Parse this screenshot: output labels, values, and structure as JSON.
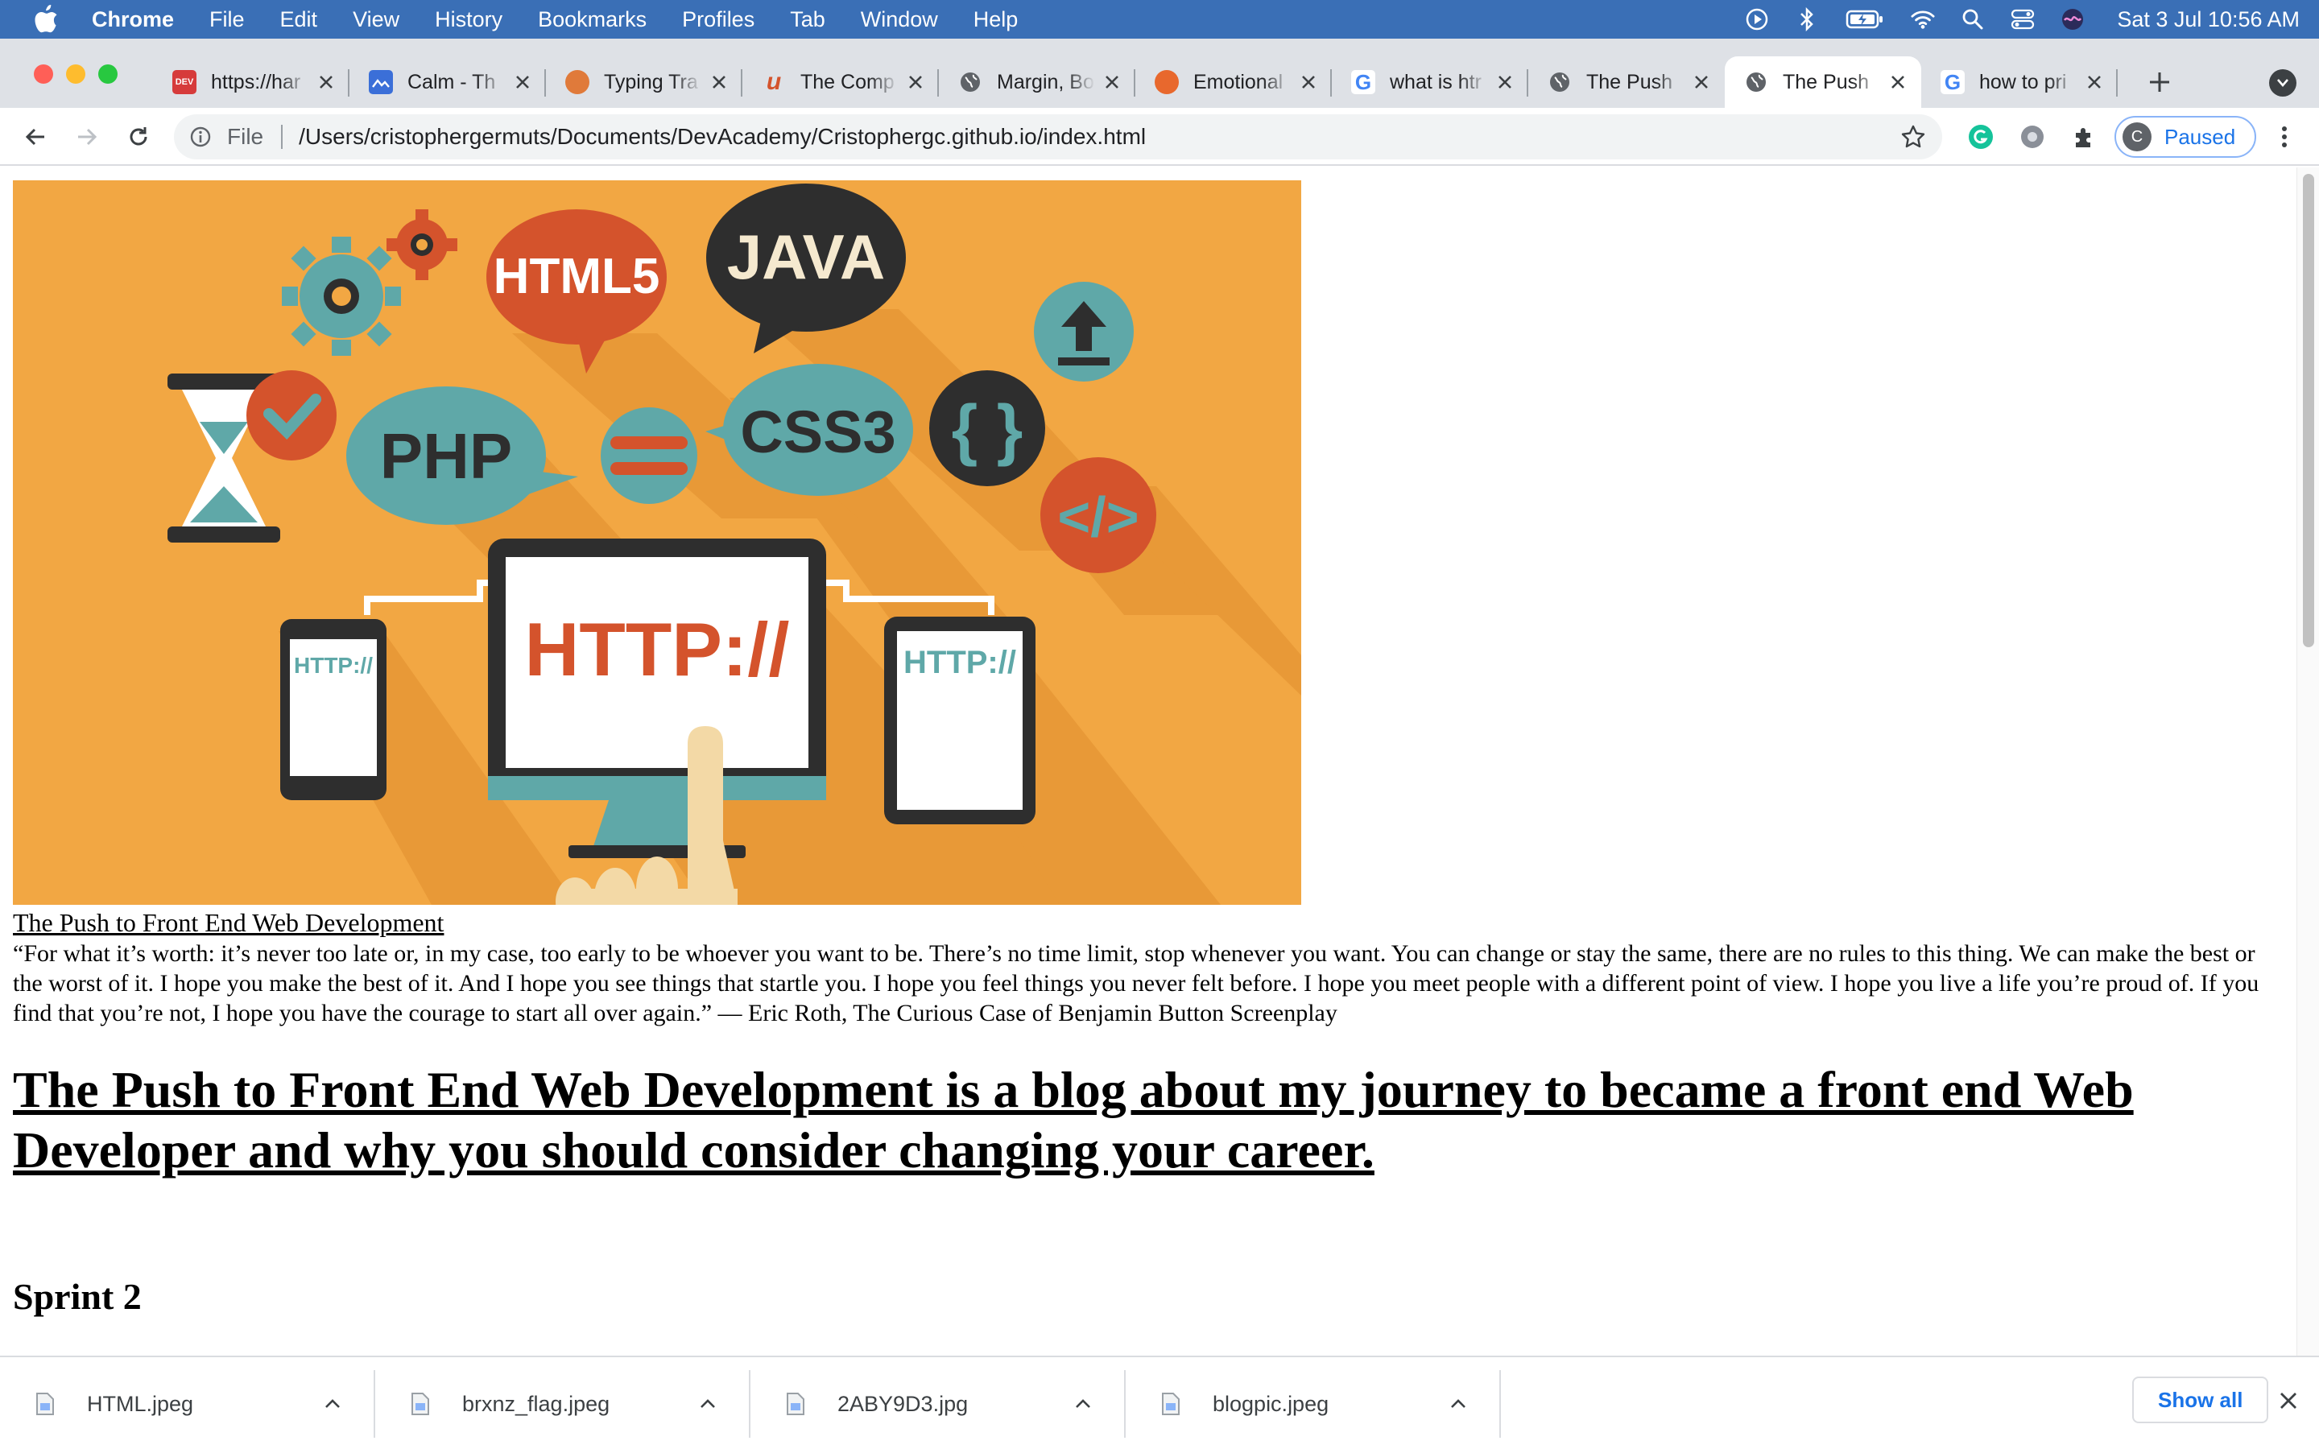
{
  "menubar": {
    "app_name": "Chrome",
    "items": [
      "File",
      "Edit",
      "View",
      "History",
      "Bookmarks",
      "Profiles",
      "Tab",
      "Window",
      "Help"
    ],
    "clock": "Sat 3 Jul  10:56 AM"
  },
  "tabs": [
    {
      "title": "https://har",
      "favicon": "dev-icon",
      "favicon_color": "#d63b3b",
      "favicon_text": "DEV"
    },
    {
      "title": "Calm - Th",
      "favicon": "calm-icon",
      "favicon_color": "#3b6fd8",
      "favicon_text": ""
    },
    {
      "title": "Typing Tra",
      "favicon": "typing-icon",
      "favicon_color": "#e07a3a",
      "favicon_text": ""
    },
    {
      "title": "The Comp",
      "favicon": "udemy-icon",
      "favicon_color": "#ffffff",
      "favicon_text": "u"
    },
    {
      "title": "Margin, Bo",
      "favicon": "globe-icon",
      "favicon_color": "#ffffff",
      "favicon_text": ""
    },
    {
      "title": "Emotional",
      "favicon": "speech-icon",
      "favicon_color": "#e8682d",
      "favicon_text": ""
    },
    {
      "title": "what is htr",
      "favicon": "google-icon",
      "favicon_color": "#ffffff",
      "favicon_text": "G"
    },
    {
      "title": "The Push",
      "favicon": "globe-icon",
      "favicon_color": "#ffffff",
      "favicon_text": ""
    },
    {
      "title": "The Push",
      "favicon": "globe-icon",
      "favicon_color": "#ffffff",
      "favicon_text": "",
      "active": true
    },
    {
      "title": "how to pri",
      "favicon": "google-icon",
      "favicon_color": "#ffffff",
      "favicon_text": "G"
    }
  ],
  "toolbar": {
    "scheme": "File",
    "url": "/Users/cristophergermuts/Documents/DevAcademy/Cristophergc.github.io/index.html",
    "profile_initial": "C",
    "profile_label": "Paused"
  },
  "page": {
    "hero_labels": {
      "html5": "HTML5",
      "java": "JAVA",
      "php": "PHP",
      "css3": "CSS3",
      "braces": "{ }",
      "code": "</>",
      "http_main": "HTTP://",
      "http_left": "HTTP://",
      "http_right": "HTTP://"
    },
    "blog_link": "The Push to Front End Web Development",
    "quote": "“For what it’s worth: it’s never too late or, in my case, too early to be whoever you want to be. There’s no time limit, stop whenever you want. You can change or stay the same, there are no rules to this thing. We can make the best or the worst of it. I hope you make the best of it. And I hope you see things that startle you. I hope you feel things you never felt before. I hope you meet people with a different point of view. I hope you live a life you’re proud of. If you find that you’re not, I hope you have the courage to start all over again.” — Eric Roth, The Curious Case of Benjamin Button Screenplay",
    "headline": "The Push to Front End Web Development is a blog about my journey to became a front end Web Developer and why you should consider changing your career.",
    "section_title": "Sprint 2"
  },
  "downloads": {
    "items": [
      "HTML.jpeg",
      "brxnz_flag.jpeg",
      "2ABY9D3.jpg",
      "blogpic.jpeg"
    ],
    "show_all": "Show all"
  },
  "colors": {
    "menubar": "#3a6fb6",
    "hero_bg": "#f2a743",
    "accent_red": "#d4532c",
    "accent_teal": "#5fa8a8",
    "dark": "#2e2e2e",
    "link_blue": "#1a73e8"
  }
}
